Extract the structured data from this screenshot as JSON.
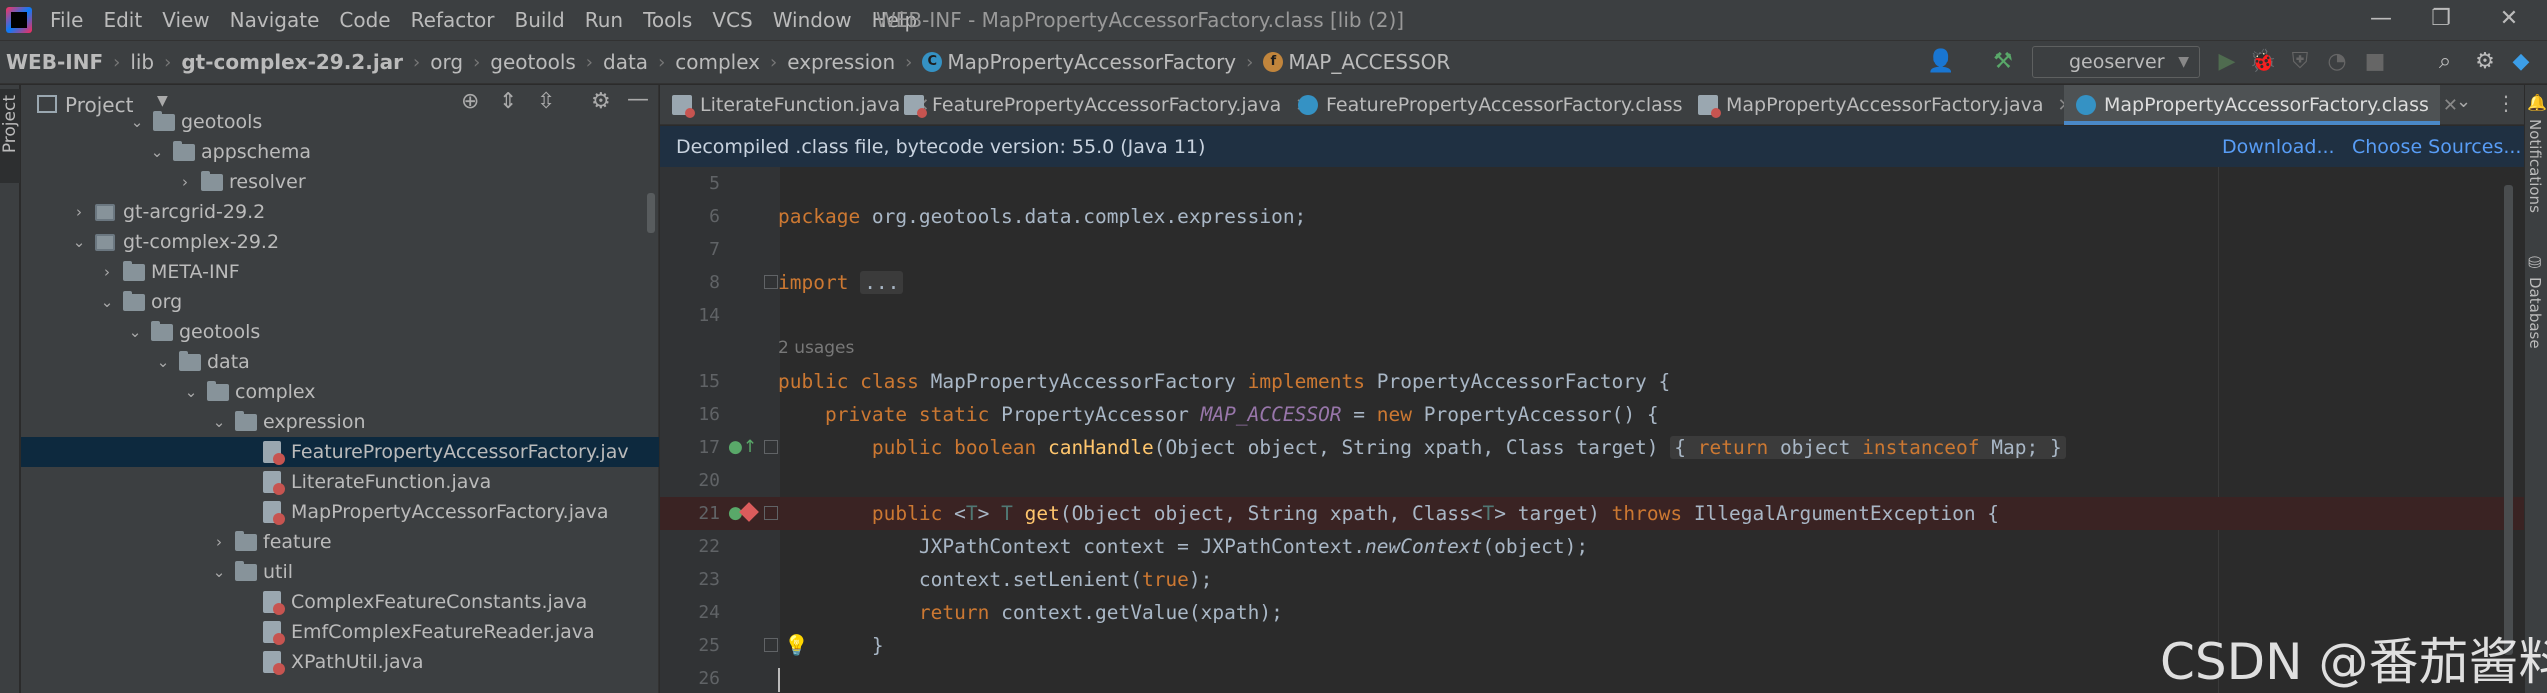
{
  "menubar": {
    "items": [
      "File",
      "Edit",
      "View",
      "Navigate",
      "Code",
      "Refactor",
      "Build",
      "Run",
      "Tools",
      "VCS",
      "Window",
      "Help"
    ],
    "title": "WEB-INF - MapPropertyAccessorFactory.class [lib (2)]"
  },
  "breadcrumb": {
    "items": [
      "WEB-INF",
      "lib",
      "gt-complex-29.2.jar",
      "org",
      "geotools",
      "data",
      "complex",
      "expression",
      "MapPropertyAccessorFactory",
      "MAP_ACCESSOR"
    ]
  },
  "toolbar": {
    "run_config": "geoserver"
  },
  "project_panel": {
    "title": "Project",
    "stripe_label": "Project",
    "tree": [
      {
        "label": "geotools",
        "kind": "folder",
        "arrow": "down"
      },
      {
        "label": "appschema",
        "kind": "folder",
        "arrow": "down"
      },
      {
        "label": "resolver",
        "kind": "folder",
        "arrow": "right"
      },
      {
        "label": "gt-arcgrid-29.2",
        "kind": "jar",
        "arrow": "right"
      },
      {
        "label": "gt-complex-29.2",
        "kind": "jar",
        "arrow": "down"
      },
      {
        "label": "META-INF",
        "kind": "folder",
        "arrow": "right"
      },
      {
        "label": "org",
        "kind": "folder",
        "arrow": "down"
      },
      {
        "label": "geotools",
        "kind": "folder",
        "arrow": "down"
      },
      {
        "label": "data",
        "kind": "folder",
        "arrow": "down"
      },
      {
        "label": "complex",
        "kind": "folder",
        "arrow": "down"
      },
      {
        "label": "expression",
        "kind": "folder",
        "arrow": "down"
      },
      {
        "label": "FeaturePropertyAccessorFactory.jav",
        "kind": "file",
        "arrow": ""
      },
      {
        "label": "LiterateFunction.java",
        "kind": "file",
        "arrow": ""
      },
      {
        "label": "MapPropertyAccessorFactory.java",
        "kind": "file",
        "arrow": ""
      },
      {
        "label": "feature",
        "kind": "folder",
        "arrow": "right"
      },
      {
        "label": "util",
        "kind": "folder",
        "arrow": "down"
      },
      {
        "label": "ComplexFeatureConstants.java",
        "kind": "file",
        "arrow": ""
      },
      {
        "label": "EmfComplexFeatureReader.java",
        "kind": "file",
        "arrow": ""
      },
      {
        "label": "XPathUtil.java",
        "kind": "file",
        "arrow": ""
      }
    ]
  },
  "editor": {
    "tabs": [
      {
        "label": "LiterateFunction.java",
        "type": "java"
      },
      {
        "label": "FeaturePropertyAccessorFactory.java",
        "type": "java"
      },
      {
        "label": "FeaturePropertyAccessorFactory.class",
        "type": "class"
      },
      {
        "label": "MapPropertyAccessorFactory.java",
        "type": "java"
      },
      {
        "label": "MapPropertyAccessorFactory.class",
        "type": "class"
      }
    ],
    "banner": {
      "text": "Decompiled .class file, bytecode version: 55.0 (Java 11)",
      "download": "Download...",
      "choose_sources": "Choose Sources..."
    },
    "line_numbers": [
      "5",
      "6",
      "7",
      "8",
      "14",
      "",
      "15",
      "16",
      "17",
      "20",
      "21",
      "22",
      "23",
      "24",
      "25",
      "26"
    ],
    "usages": "2 usages",
    "fold_placeholder": "..."
  },
  "right_stripe": {
    "notifications": "Notifications",
    "database": "Database"
  },
  "watermark": "CSDN @番茄酱料"
}
